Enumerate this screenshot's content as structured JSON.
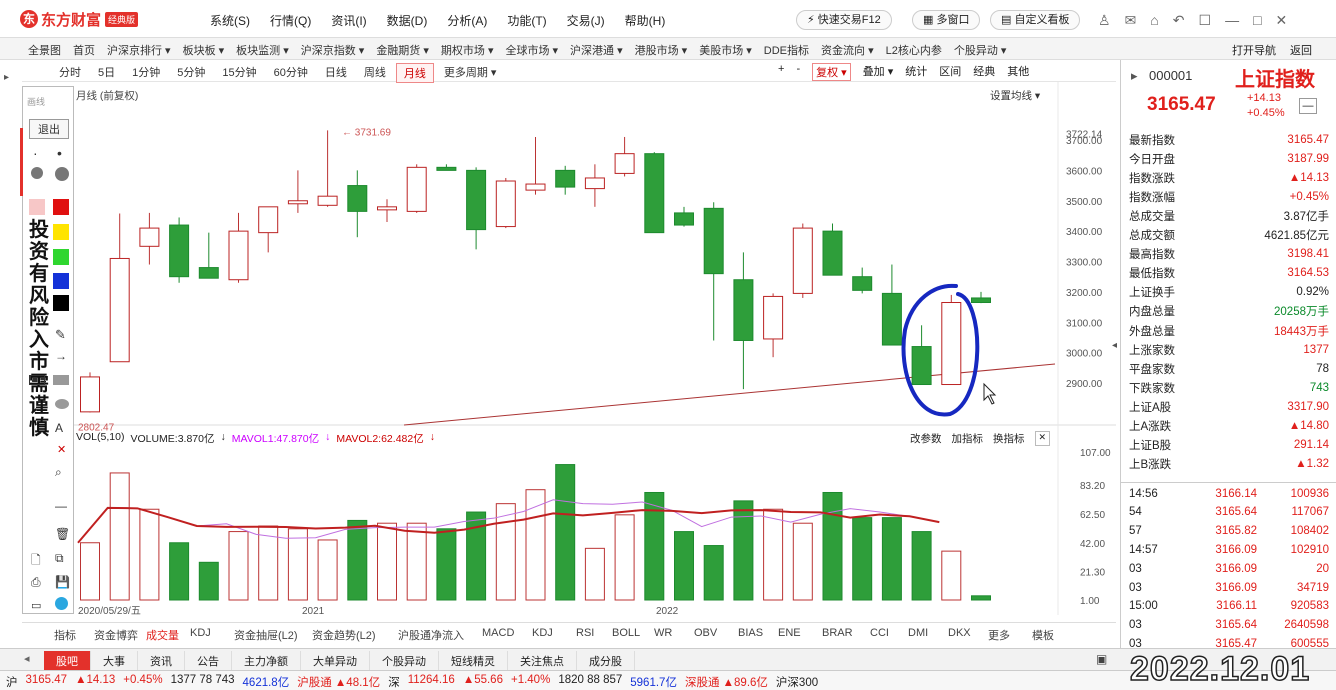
{
  "app": {
    "logo_text": "东方财富",
    "edition": "经典版"
  },
  "menu": [
    "系统(S)",
    "行情(Q)",
    "资讯(I)",
    "数据(D)",
    "分析(A)",
    "功能(T)",
    "交易(J)",
    "帮助(H)"
  ],
  "quick_trade": "快速交易F12",
  "multi_window": "多窗口",
  "custom_board": "自定义看板",
  "nav": [
    "全景图",
    "首页",
    "沪深京排行 ▾",
    "板块板 ▾",
    "板块监测 ▾",
    "沪深京指数 ▾",
    "金融期货 ▾",
    "期权市场 ▾",
    "全球市场 ▾",
    "沪深港通 ▾",
    "港股市场 ▾",
    "美股市场 ▾",
    "DDE指标",
    "资金流向 ▾",
    "L2核心内参",
    "个股异动 ▾"
  ],
  "nav_right": [
    "打开导航",
    "返回"
  ],
  "periods": [
    "分时",
    "5日",
    "1分钟",
    "5分钟",
    "15分钟",
    "60分钟",
    "日线",
    "周线",
    "月线",
    "更多周期 ▾"
  ],
  "active_period": "月线",
  "chart_tools": [
    "+",
    "-",
    "复权 ▾",
    "叠加 ▾",
    "统计",
    "区间",
    "经典",
    "其他"
  ],
  "main_chart_label": "月线 (前复权)",
  "ma_setting": "设置均线 ▾",
  "high_label": "3731.69",
  "low_label": "2802.47",
  "draw": {
    "title": "画线",
    "exit": "退出",
    "stamp": [
      "投",
      "资",
      "有",
      "风",
      "险",
      "入",
      "市",
      "需",
      "谨",
      "慎"
    ]
  },
  "volume_legend": {
    "vol": "VOL(5,10)",
    "volume": "VOLUME:3.870亿",
    "mavol1": "MAVOL1:47.870亿",
    "mavol2": "MAVOL2:62.482亿",
    "buttons": [
      "改参数",
      "加指标",
      "换指标"
    ]
  },
  "chart_data": {
    "type": "candlestick",
    "price_axis": [
      3722.14,
      3700.0,
      3600.0,
      3500.0,
      3400.0,
      3300.0,
      3200.0,
      3100.0,
      3000.0,
      2900.0
    ],
    "volume_axis": [
      107.0,
      83.2,
      62.5,
      42.0,
      21.3,
      1.0
    ],
    "x_labels": [
      "2020/05/29/五",
      "2021",
      "2022"
    ],
    "candles": [
      {
        "o": 2805,
        "h": 2935,
        "l": 2803,
        "c": 2920
      },
      {
        "o": 2970,
        "h": 3458,
        "l": 2970,
        "c": 3310
      },
      {
        "o": 3350,
        "h": 3460,
        "l": 3290,
        "c": 3410
      },
      {
        "o": 3420,
        "h": 3445,
        "l": 3230,
        "c": 3250
      },
      {
        "o": 3280,
        "h": 3395,
        "l": 3260,
        "c": 3245
      },
      {
        "o": 3240,
        "h": 3460,
        "l": 3230,
        "c": 3400
      },
      {
        "o": 3395,
        "h": 3475,
        "l": 3330,
        "c": 3480
      },
      {
        "o": 3490,
        "h": 3600,
        "l": 3460,
        "c": 3500
      },
      {
        "o": 3485,
        "h": 3731.69,
        "l": 3480,
        "c": 3515
      },
      {
        "o": 3550,
        "h": 3600,
        "l": 3380,
        "c": 3465
      },
      {
        "o": 3470,
        "h": 3505,
        "l": 3430,
        "c": 3480
      },
      {
        "o": 3465,
        "h": 3620,
        "l": 3460,
        "c": 3610
      },
      {
        "o": 3610,
        "h": 3620,
        "l": 3600,
        "c": 3600
      },
      {
        "o": 3600,
        "h": 3610,
        "l": 3340,
        "c": 3405
      },
      {
        "o": 3415,
        "h": 3575,
        "l": 3410,
        "c": 3565
      },
      {
        "o": 3535,
        "h": 3710,
        "l": 3520,
        "c": 3555
      },
      {
        "o": 3600,
        "h": 3615,
        "l": 3520,
        "c": 3545
      },
      {
        "o": 3540,
        "h": 3620,
        "l": 3480,
        "c": 3575
      },
      {
        "o": 3590,
        "h": 3710,
        "l": 3580,
        "c": 3655
      },
      {
        "o": 3655,
        "h": 3660,
        "l": 3400,
        "c": 3395
      },
      {
        "o": 3460,
        "h": 3480,
        "l": 3415,
        "c": 3420
      },
      {
        "o": 3475,
        "h": 3495,
        "l": 3040,
        "c": 3260
      },
      {
        "o": 3240,
        "h": 3330,
        "l": 2880,
        "c": 3040
      },
      {
        "o": 3045,
        "h": 3195,
        "l": 2985,
        "c": 3185
      },
      {
        "o": 3195,
        "h": 3425,
        "l": 3180,
        "c": 3410
      },
      {
        "o": 3400,
        "h": 3425,
        "l": 3260,
        "c": 3255
      },
      {
        "o": 3250,
        "h": 3280,
        "l": 3195,
        "c": 3205
      },
      {
        "o": 3195,
        "h": 3290,
        "l": 3030,
        "c": 3025
      },
      {
        "o": 3020,
        "h": 3090,
        "l": 2905,
        "c": 2895
      },
      {
        "o": 2895,
        "h": 3190,
        "l": 2895,
        "c": 3165
      },
      {
        "o": 3180,
        "h": 3200,
        "l": 3163,
        "c": 3165
      }
    ],
    "volumes": [
      42,
      92,
      66,
      42,
      28,
      50,
      54,
      52,
      44,
      58,
      56,
      56,
      52,
      64,
      70,
      80,
      98,
      38,
      62,
      78,
      50,
      40,
      72,
      66,
      56,
      78,
      60,
      60,
      50,
      36,
      4
    ]
  },
  "ind_tabs": [
    "指标",
    "资金博弈",
    "成交量",
    "KDJ",
    "资金抽屉(L2)",
    "资金趋势(L2)",
    "沪股通净流入",
    "MACD",
    "KDJ",
    "RSI",
    "BOLL",
    "WR",
    "OBV",
    "BIAS",
    "ENE",
    "BRAR",
    "CCI",
    "DMI",
    "DKX",
    "更多",
    "模板"
  ],
  "active_ind": "成交量",
  "quote": {
    "code": "000001",
    "name": "上证指数",
    "price": "3165.47",
    "change": "+14.13",
    "pct": "+0.45%",
    "rows": [
      {
        "k": "最新指数",
        "v": "3165.47",
        "c": "red"
      },
      {
        "k": "今日开盘",
        "v": "3187.99",
        "c": "red"
      },
      {
        "k": "指数涨跌",
        "v": "▲14.13",
        "c": "red"
      },
      {
        "k": "指数涨幅",
        "v": "+0.45%",
        "c": "red"
      },
      {
        "k": "总成交量",
        "v": "3.87亿手",
        "c": ""
      },
      {
        "k": "总成交额",
        "v": "4621.85亿元",
        "c": ""
      },
      {
        "k": "最高指数",
        "v": "3198.41",
        "c": "red"
      },
      {
        "k": "最低指数",
        "v": "3164.53",
        "c": "red"
      },
      {
        "k": "上证换手",
        "v": "0.92%",
        "c": ""
      },
      {
        "k": "内盘总量",
        "v": "20258万手",
        "c": "green"
      },
      {
        "k": "外盘总量",
        "v": "18443万手",
        "c": "red"
      },
      {
        "k": "上涨家数",
        "v": "1377",
        "c": "red"
      },
      {
        "k": "平盘家数",
        "v": "78",
        "c": ""
      },
      {
        "k": "下跌家数",
        "v": "743",
        "c": "green"
      },
      {
        "k": "上证A股",
        "v": "3317.90",
        "c": "red"
      },
      {
        "k": "上A涨跌",
        "v": "▲14.80",
        "c": "red"
      },
      {
        "k": "上证B股",
        "v": "291.14",
        "c": "red"
      },
      {
        "k": "上B涨跌",
        "v": "▲1.32",
        "c": "red"
      }
    ],
    "ticks": [
      {
        "t": "14:56",
        "p": "3166.14",
        "v": "100936"
      },
      {
        "t": "54",
        "p": "3165.64",
        "v": "117067"
      },
      {
        "t": "57",
        "p": "3165.82",
        "v": "108402"
      },
      {
        "t": "14:57",
        "p": "3166.09",
        "v": "102910"
      },
      {
        "t": "03",
        "p": "3166.09",
        "v": "20"
      },
      {
        "t": "03",
        "p": "3166.09",
        "v": "34719"
      },
      {
        "t": "15:00",
        "p": "3166.11",
        "v": "920583"
      },
      {
        "t": "03",
        "p": "3165.64",
        "v": "2640598"
      },
      {
        "t": "03",
        "p": "3165.47",
        "v": "600555"
      }
    ]
  },
  "tabs": [
    "股吧",
    "大事",
    "资讯",
    "公告",
    "主力净额",
    "大单异动",
    "个股异动",
    "短线精灵",
    "关注焦点",
    "成分股"
  ],
  "active_tab": "股吧",
  "status": [
    "沪",
    "3165.47",
    "▲14.13",
    "+0.45%",
    "1377 78 743",
    "4621.8亿",
    "沪股通 ▲48.1亿",
    "深",
    "11264.16",
    "▲55.66",
    "+1.40%",
    "1820 88 857",
    "5961.7亿",
    "深股通 ▲89.6亿",
    "沪深300"
  ],
  "datestamp": "2022.12.01"
}
